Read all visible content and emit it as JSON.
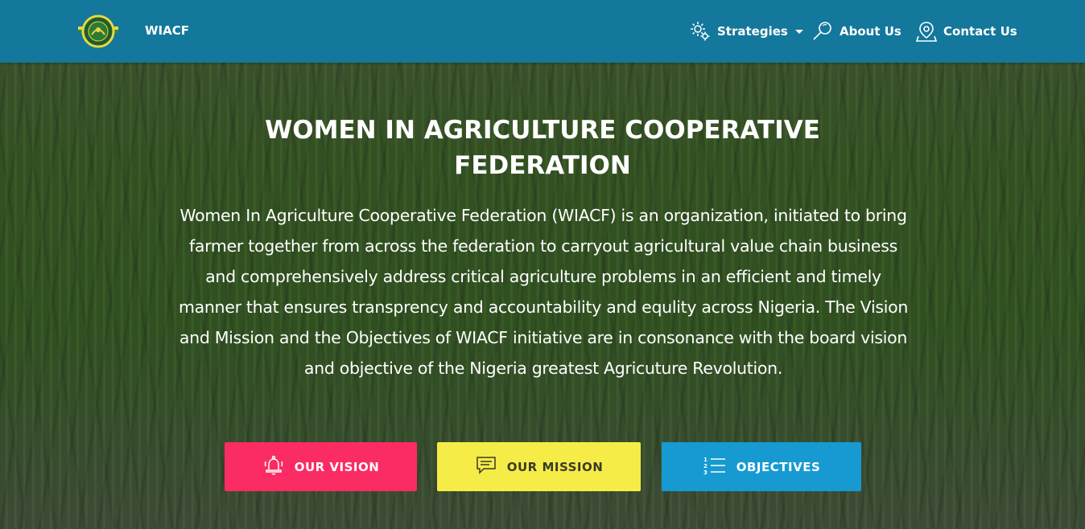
{
  "navbar": {
    "brand": "WIACF",
    "items": [
      {
        "label": "Strategies",
        "icon": "gears-icon",
        "has_dropdown": true
      },
      {
        "label": "About Us",
        "icon": "magnifier-icon"
      },
      {
        "label": "Contact Us",
        "icon": "map-pin-icon"
      }
    ]
  },
  "hero": {
    "title_line1": "WOMEN IN AGRICULTURE COOPERATIVE",
    "title_line2": "FEDERATION",
    "description": "Women In Agriculture Cooperative Federation (WIACF) is an organization, initiated to bring farmer together from across the federation to carryout agricultural value chain business and comprehensively address critical agriculture problems in an efficient and timely manner that ensures transprency and accountability and equlity across Nigeria. The Vision and Mission and the Objectives of WIACF initiative are in consonance with the board vision and objective of the Nigeria greatest Agricuture Revolution."
  },
  "buttons": {
    "vision": {
      "label": "OUR VISION",
      "icon": "bell-icon",
      "color": "#fb2b63"
    },
    "mission": {
      "label": "OUR MISSION",
      "icon": "chat-bubble-icon",
      "color": "#f6ec47"
    },
    "objectives": {
      "label": "OBJECTIVES",
      "icon": "numbered-list-icon",
      "color": "#169ad1"
    }
  },
  "colors": {
    "navbar": "#13789b"
  }
}
